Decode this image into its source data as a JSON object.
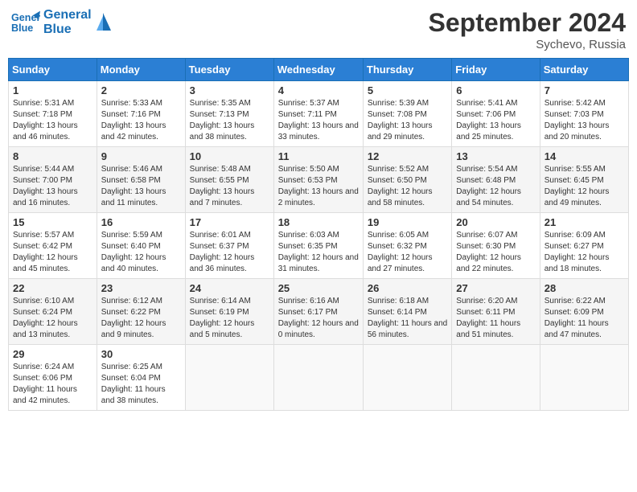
{
  "header": {
    "logo_line1": "General",
    "logo_line2": "Blue",
    "month": "September 2024",
    "location": "Sychevo, Russia"
  },
  "days_of_week": [
    "Sunday",
    "Monday",
    "Tuesday",
    "Wednesday",
    "Thursday",
    "Friday",
    "Saturday"
  ],
  "weeks": [
    [
      {
        "day": "1",
        "sunrise": "5:31 AM",
        "sunset": "7:18 PM",
        "daylight": "13 hours and 46 minutes."
      },
      {
        "day": "2",
        "sunrise": "5:33 AM",
        "sunset": "7:16 PM",
        "daylight": "13 hours and 42 minutes."
      },
      {
        "day": "3",
        "sunrise": "5:35 AM",
        "sunset": "7:13 PM",
        "daylight": "13 hours and 38 minutes."
      },
      {
        "day": "4",
        "sunrise": "5:37 AM",
        "sunset": "7:11 PM",
        "daylight": "13 hours and 33 minutes."
      },
      {
        "day": "5",
        "sunrise": "5:39 AM",
        "sunset": "7:08 PM",
        "daylight": "13 hours and 29 minutes."
      },
      {
        "day": "6",
        "sunrise": "5:41 AM",
        "sunset": "7:06 PM",
        "daylight": "13 hours and 25 minutes."
      },
      {
        "day": "7",
        "sunrise": "5:42 AM",
        "sunset": "7:03 PM",
        "daylight": "13 hours and 20 minutes."
      }
    ],
    [
      {
        "day": "8",
        "sunrise": "5:44 AM",
        "sunset": "7:00 PM",
        "daylight": "13 hours and 16 minutes."
      },
      {
        "day": "9",
        "sunrise": "5:46 AM",
        "sunset": "6:58 PM",
        "daylight": "13 hours and 11 minutes."
      },
      {
        "day": "10",
        "sunrise": "5:48 AM",
        "sunset": "6:55 PM",
        "daylight": "13 hours and 7 minutes."
      },
      {
        "day": "11",
        "sunrise": "5:50 AM",
        "sunset": "6:53 PM",
        "daylight": "13 hours and 2 minutes."
      },
      {
        "day": "12",
        "sunrise": "5:52 AM",
        "sunset": "6:50 PM",
        "daylight": "12 hours and 58 minutes."
      },
      {
        "day": "13",
        "sunrise": "5:54 AM",
        "sunset": "6:48 PM",
        "daylight": "12 hours and 54 minutes."
      },
      {
        "day": "14",
        "sunrise": "5:55 AM",
        "sunset": "6:45 PM",
        "daylight": "12 hours and 49 minutes."
      }
    ],
    [
      {
        "day": "15",
        "sunrise": "5:57 AM",
        "sunset": "6:42 PM",
        "daylight": "12 hours and 45 minutes."
      },
      {
        "day": "16",
        "sunrise": "5:59 AM",
        "sunset": "6:40 PM",
        "daylight": "12 hours and 40 minutes."
      },
      {
        "day": "17",
        "sunrise": "6:01 AM",
        "sunset": "6:37 PM",
        "daylight": "12 hours and 36 minutes."
      },
      {
        "day": "18",
        "sunrise": "6:03 AM",
        "sunset": "6:35 PM",
        "daylight": "12 hours and 31 minutes."
      },
      {
        "day": "19",
        "sunrise": "6:05 AM",
        "sunset": "6:32 PM",
        "daylight": "12 hours and 27 minutes."
      },
      {
        "day": "20",
        "sunrise": "6:07 AM",
        "sunset": "6:30 PM",
        "daylight": "12 hours and 22 minutes."
      },
      {
        "day": "21",
        "sunrise": "6:09 AM",
        "sunset": "6:27 PM",
        "daylight": "12 hours and 18 minutes."
      }
    ],
    [
      {
        "day": "22",
        "sunrise": "6:10 AM",
        "sunset": "6:24 PM",
        "daylight": "12 hours and 13 minutes."
      },
      {
        "day": "23",
        "sunrise": "6:12 AM",
        "sunset": "6:22 PM",
        "daylight": "12 hours and 9 minutes."
      },
      {
        "day": "24",
        "sunrise": "6:14 AM",
        "sunset": "6:19 PM",
        "daylight": "12 hours and 5 minutes."
      },
      {
        "day": "25",
        "sunrise": "6:16 AM",
        "sunset": "6:17 PM",
        "daylight": "12 hours and 0 minutes."
      },
      {
        "day": "26",
        "sunrise": "6:18 AM",
        "sunset": "6:14 PM",
        "daylight": "11 hours and 56 minutes."
      },
      {
        "day": "27",
        "sunrise": "6:20 AM",
        "sunset": "6:11 PM",
        "daylight": "11 hours and 51 minutes."
      },
      {
        "day": "28",
        "sunrise": "6:22 AM",
        "sunset": "6:09 PM",
        "daylight": "11 hours and 47 minutes."
      }
    ],
    [
      {
        "day": "29",
        "sunrise": "6:24 AM",
        "sunset": "6:06 PM",
        "daylight": "11 hours and 42 minutes."
      },
      {
        "day": "30",
        "sunrise": "6:25 AM",
        "sunset": "6:04 PM",
        "daylight": "11 hours and 38 minutes."
      },
      {
        "day": "",
        "sunrise": "",
        "sunset": "",
        "daylight": ""
      },
      {
        "day": "",
        "sunrise": "",
        "sunset": "",
        "daylight": ""
      },
      {
        "day": "",
        "sunrise": "",
        "sunset": "",
        "daylight": ""
      },
      {
        "day": "",
        "sunrise": "",
        "sunset": "",
        "daylight": ""
      },
      {
        "day": "",
        "sunrise": "",
        "sunset": "",
        "daylight": ""
      }
    ]
  ]
}
